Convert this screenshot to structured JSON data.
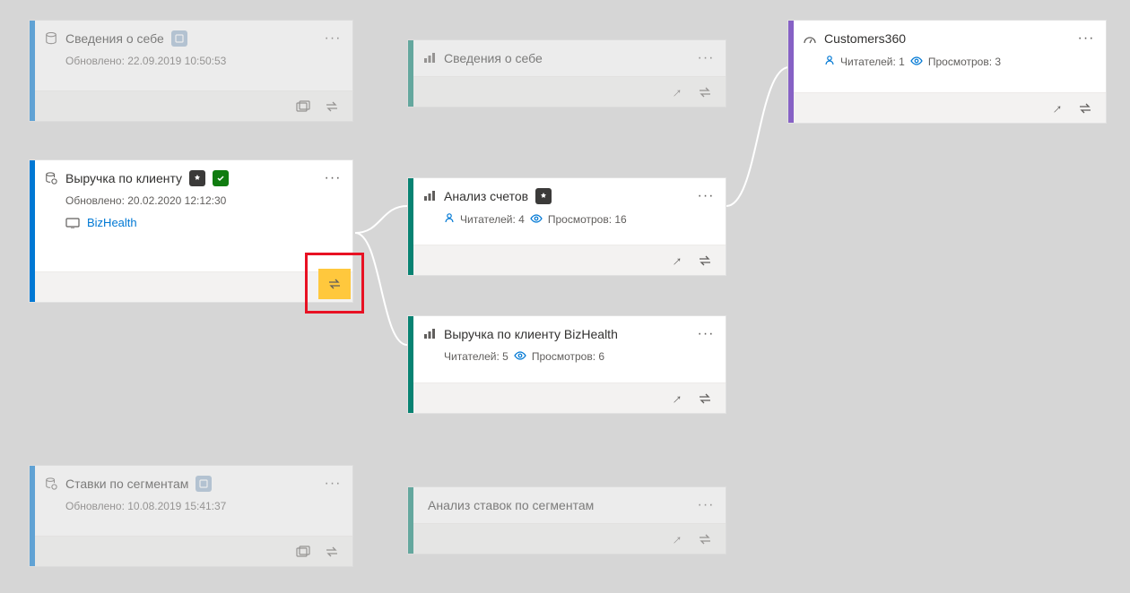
{
  "cards": {
    "ds1": {
      "title": "Сведения о себе",
      "updated": "Обновлено: 22.09.2019 10:50:53"
    },
    "ds2": {
      "title": "Выручка по клиенту",
      "updated": "Обновлено: 20.02.2020 12:12:30",
      "workspace": "BizHealth"
    },
    "ds3": {
      "title": "Ставки по сегментам",
      "updated": "Обновлено: 10.08.2019 15:41:37"
    },
    "rep1": {
      "title": "Сведения о себе"
    },
    "rep2": {
      "title": "Анализ счетов",
      "readers_label": "Читателей: 4",
      "views_label": "Просмотров: 16"
    },
    "rep3": {
      "title": "Выручка по клиенту BizHealth",
      "readers_label": "Читателей: 5",
      "views_label": "Просмотров: 6"
    },
    "rep4": {
      "title": "Анализ ставок по сегментам"
    },
    "dash1": {
      "title": "Customers360",
      "readers_label": "Читателей: 1",
      "views_label": "Просмотров: 3"
    }
  },
  "icons": {
    "more": "···"
  }
}
